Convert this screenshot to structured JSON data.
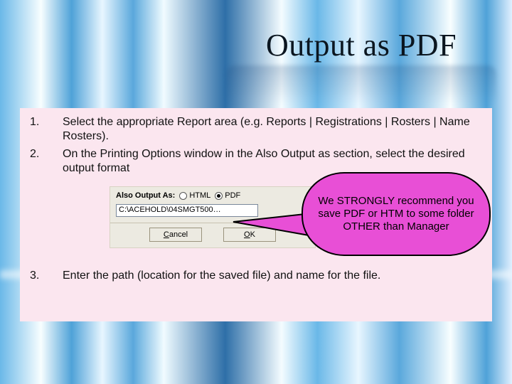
{
  "slide": {
    "title": "Output as PDF"
  },
  "steps": {
    "n1": "1.",
    "n2": "2.",
    "n3": "3.",
    "s1": "Select the appropriate Report area (e.g. Reports | Registrations | Rosters | Name Rosters).",
    "s2": "On the Printing Options window in the Also Output as section, select the desired output format",
    "s3": "Enter the path (location for the saved file) and name for the file."
  },
  "dialog": {
    "also_label": "Also Output As:",
    "opt_html": "HTML",
    "opt_pdf": "PDF",
    "selected": "PDF",
    "path_value": "C:\\ACEHOLD\\04SMGT500…",
    "cancel": "Cancel",
    "ok": "OK"
  },
  "callout": {
    "text": "We STRONGLY recommend you save PDF or HTM to some folder OTHER than Manager"
  }
}
